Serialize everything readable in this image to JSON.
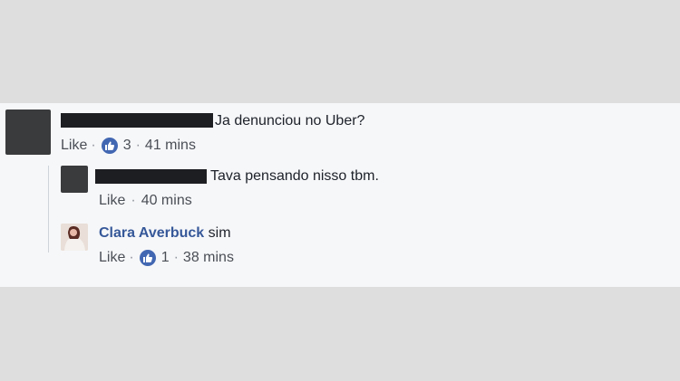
{
  "comments": [
    {
      "text": "Ja denunciou no Uber?",
      "like_label": "Like",
      "sep": "·",
      "like_count": "3",
      "time": "41 mins"
    },
    {
      "text": "Tava pensando nisso tbm.",
      "like_label": "Like",
      "sep": "·",
      "time": "40 mins"
    },
    {
      "author": "Clara Averbuck",
      "text": "sim",
      "like_label": "Like",
      "sep": "·",
      "like_count": "1",
      "time": "38 mins"
    }
  ],
  "icons": {
    "like_badge": "thumbs-up-icon"
  },
  "colors": {
    "accent": "#4267b2",
    "author_name": "#365899",
    "meta": "#90949c"
  }
}
